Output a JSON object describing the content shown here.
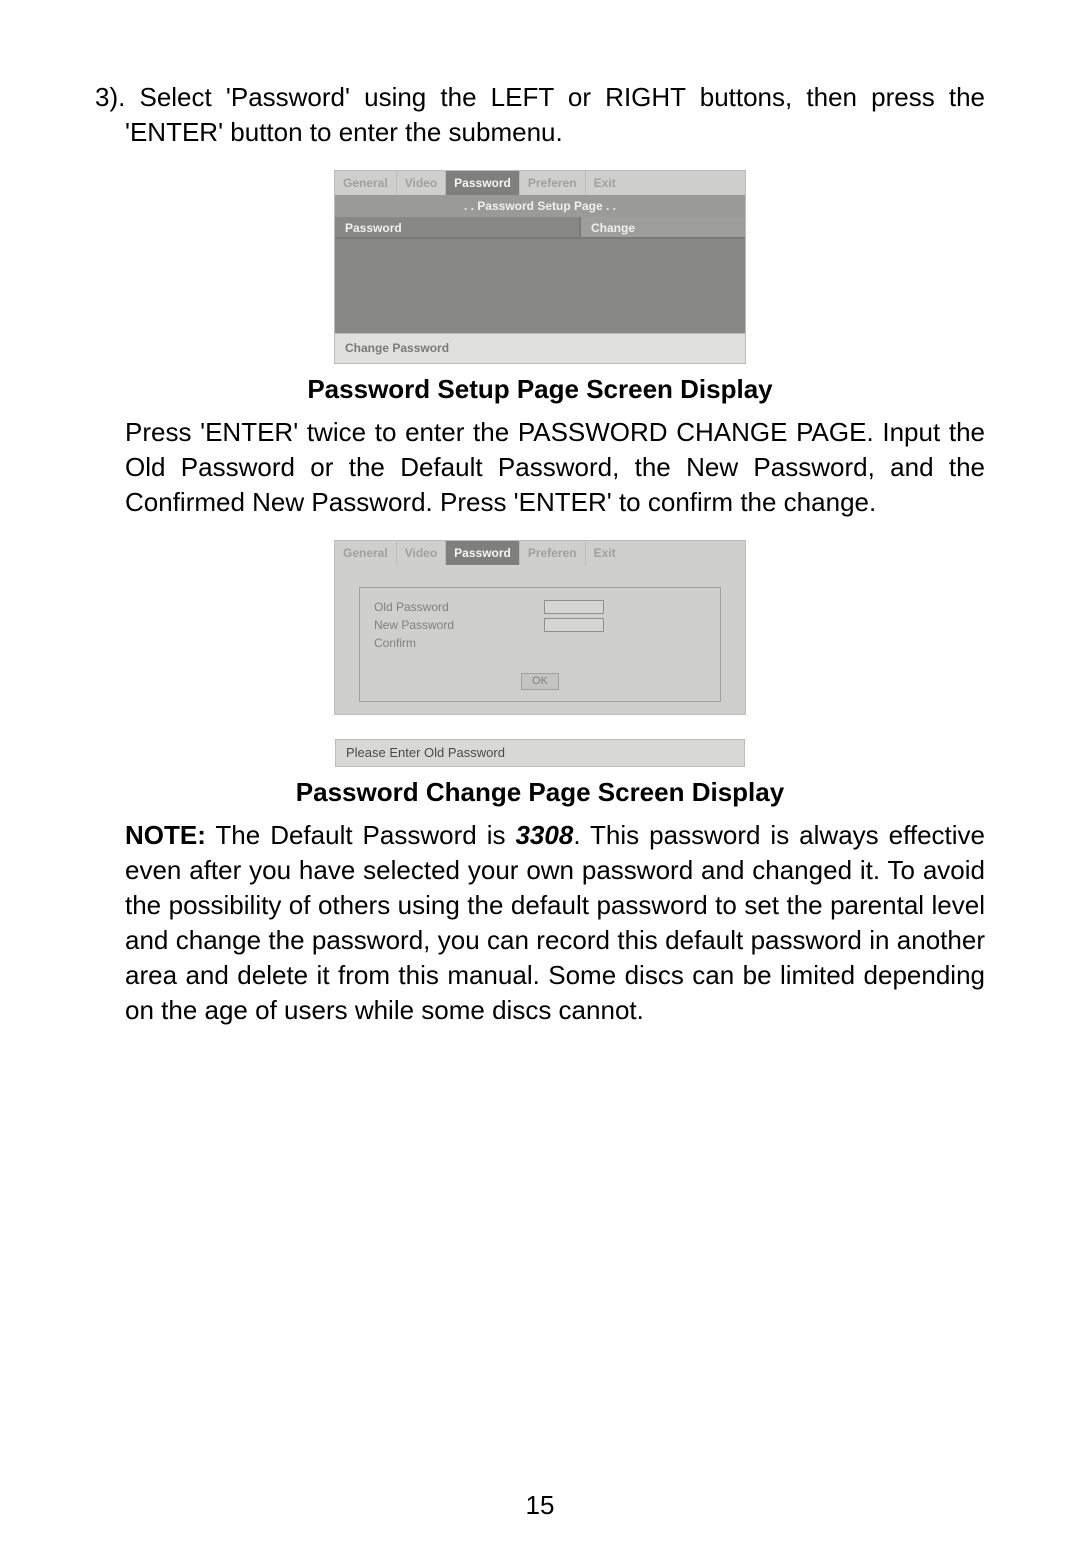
{
  "step": {
    "line": "3). Select 'Password' using the  LEFT or RIGHT buttons, then press the 'ENTER' button to enter the submenu."
  },
  "screenshot1": {
    "tabs": [
      "General",
      "Video",
      "Password",
      "Preferen",
      "Exit"
    ],
    "active_tab": "Password",
    "title": ". . Password Setup Page . .",
    "row_label": "Password",
    "row_value": "Change",
    "footer": "Change Password"
  },
  "caption1": "Password Setup Page Screen Display",
  "para1": "Press 'ENTER' twice to enter the PASSWORD CHANGE PAGE. Input the Old  Password or the Default Password, the New Password, and the Confirmed New Password. Press 'ENTER' to confirm the change.",
  "screenshot2": {
    "tabs": [
      "General",
      "Video",
      "Password",
      "Preferen",
      "Exit"
    ],
    "fields": [
      "Old Password",
      "New Password",
      "Confirm"
    ],
    "ok_label": "OK",
    "status": "Please Enter Old Password"
  },
  "caption2": "Password Change Page Screen Display",
  "note": {
    "prefix": "NOTE:",
    "before_pwd": " The Default Password is ",
    "default_password": "3308",
    "after_pwd": ".  This password  is always effective even after you have selected your own password  and changed it. To avoid  the possibility of others using the default password to set the parental level and change the password, you can  record  this default password in another area  and delete it from this  manual. Some discs can be limited depending on the age of users while some discs cannot."
  },
  "page_number": "15"
}
